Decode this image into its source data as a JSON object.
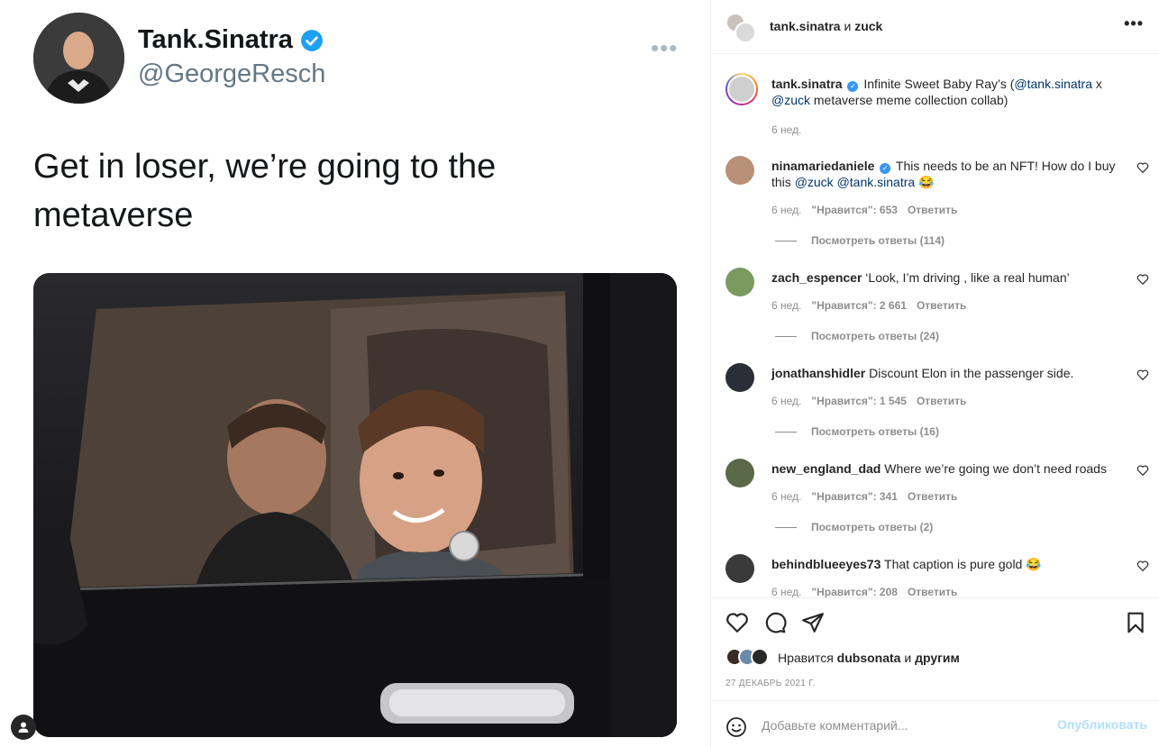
{
  "tweet": {
    "name": "Tank.Sinatra",
    "handle": "@GeorgeResch",
    "more": "•••",
    "text": "Get in loser, we’re going to the metaverse"
  },
  "header": {
    "user1": "tank.sinatra",
    "conj": "и",
    "user2": "zuck",
    "more": "•••"
  },
  "caption": {
    "username": "tank.sinatra",
    "text_before": "Infinite Sweet Baby Ray’s (",
    "mention1": "@tank.sinatra",
    "text_mid": " x ",
    "mention2": "@zuck",
    "text_after": " metaverse meme collection collab)",
    "time": "6 нед."
  },
  "comments": [
    {
      "username": "ninamariedaniele",
      "verified": true,
      "text": "This needs to be an NFT! How do I buy this ",
      "mentions": "@zuck @tank.sinatra",
      "emoji": "😂",
      "time": "6 нед.",
      "likes": "\"Нравится\": 653",
      "reply": "Ответить",
      "view_replies": "Посмотреть ответы (114)",
      "avatar_color": "#b89078"
    },
    {
      "username": "zach_espencer",
      "text": "‘Look, I’m driving , like a real human’",
      "time": "6 нед.",
      "likes": "\"Нравится\": 2 661",
      "reply": "Ответить",
      "view_replies": "Посмотреть ответы (24)",
      "avatar_color": "#7a9a60"
    },
    {
      "username": "jonathanshidler",
      "text": "Discount Elon in the passenger side.",
      "time": "6 нед.",
      "likes": "\"Нравится\": 1 545",
      "reply": "Ответить",
      "view_replies": "Посмотреть ответы (16)",
      "avatar_color": "#2b2e36"
    },
    {
      "username": "new_england_dad",
      "text": "Where we’re going we don’t need roads",
      "time": "6 нед.",
      "likes": "\"Нравится\": 341",
      "reply": "Ответить",
      "view_replies": "Посмотреть ответы (2)",
      "avatar_color": "#5a6a48"
    },
    {
      "username": "behindblueeyes73",
      "text": "That caption is pure gold ",
      "emoji": "😂",
      "time": "6 нед.",
      "likes": "\"Нравится\": 208",
      "reply": "Ответить",
      "avatar_color": "#3a3a3a"
    }
  ],
  "actions": {
    "likes_prefix": "Нравится",
    "likes_user": "dubsonata",
    "likes_and": "и",
    "likes_others": "другим",
    "date": "27 ДЕКАБРЬ 2021 Г."
  },
  "add_comment": {
    "placeholder": "Добавьте комментарий...",
    "post_label": "Опубликовать"
  },
  "colors": {
    "accent": "#0095f6",
    "verified": "#3897f0",
    "post_disabled": "#b2dffc",
    "secondary_text": "#8e8e8e"
  }
}
